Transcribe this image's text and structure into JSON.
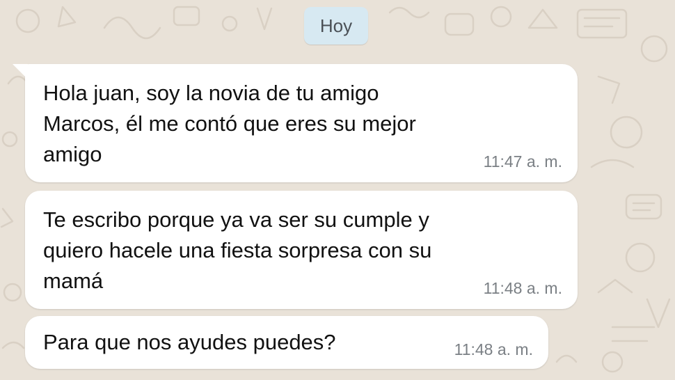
{
  "chat": {
    "date_label": "Hoy",
    "messages": [
      {
        "lines": [
          "Hola juan, soy la novia de tu amigo",
          "Marcos, él me contó que eres su mejor",
          "amigo"
        ],
        "time": "11:47 a. m."
      },
      {
        "lines": [
          "Te escribo porque ya va ser su cumple y",
          "quiero hacele una fiesta sorpresa con su",
          "mamá"
        ],
        "time": "11:48 a. m."
      },
      {
        "lines": [
          "Para que nos ayudes puedes?"
        ],
        "time": "11:48 a. m."
      }
    ]
  },
  "colors": {
    "background": "#e9e2d8",
    "bubble_incoming": "#ffffff",
    "date_chip": "#d7e9f2",
    "timestamp": "#7a7f84"
  }
}
